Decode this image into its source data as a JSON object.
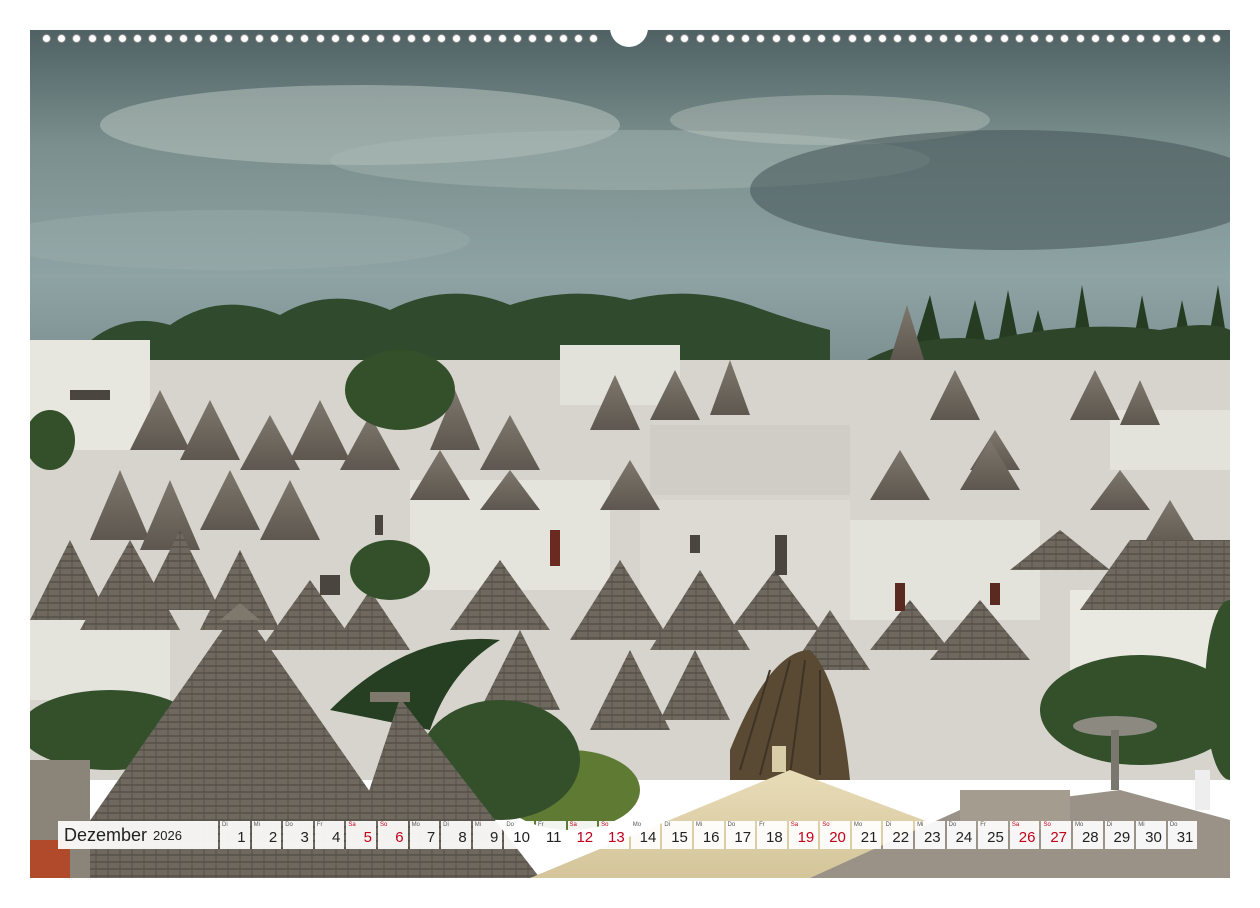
{
  "calendar": {
    "month": "Dezember",
    "year": "2026",
    "days": [
      {
        "num": "1",
        "wd": "Di"
      },
      {
        "num": "2",
        "wd": "Mi"
      },
      {
        "num": "3",
        "wd": "Do"
      },
      {
        "num": "4",
        "wd": "Fr"
      },
      {
        "num": "5",
        "wd": "Sa"
      },
      {
        "num": "6",
        "wd": "So"
      },
      {
        "num": "7",
        "wd": "Mo"
      },
      {
        "num": "8",
        "wd": "Di"
      },
      {
        "num": "9",
        "wd": "Mi"
      },
      {
        "num": "10",
        "wd": "Do"
      },
      {
        "num": "11",
        "wd": "Fr"
      },
      {
        "num": "12",
        "wd": "Sa"
      },
      {
        "num": "13",
        "wd": "So"
      },
      {
        "num": "14",
        "wd": "Mo"
      },
      {
        "num": "15",
        "wd": "Di"
      },
      {
        "num": "16",
        "wd": "Mi"
      },
      {
        "num": "17",
        "wd": "Do"
      },
      {
        "num": "18",
        "wd": "Fr"
      },
      {
        "num": "19",
        "wd": "Sa"
      },
      {
        "num": "20",
        "wd": "So"
      },
      {
        "num": "21",
        "wd": "Mo"
      },
      {
        "num": "22",
        "wd": "Di"
      },
      {
        "num": "23",
        "wd": "Mi"
      },
      {
        "num": "24",
        "wd": "Do"
      },
      {
        "num": "25",
        "wd": "Fr"
      },
      {
        "num": "26",
        "wd": "Sa"
      },
      {
        "num": "27",
        "wd": "So"
      },
      {
        "num": "28",
        "wd": "Mo"
      },
      {
        "num": "29",
        "wd": "Di"
      },
      {
        "num": "30",
        "wd": "Mi"
      },
      {
        "num": "31",
        "wd": "Do"
      }
    ],
    "holiday_color": "#c0001a"
  },
  "photo": {
    "subject": "trulli-rooftops-photo"
  }
}
